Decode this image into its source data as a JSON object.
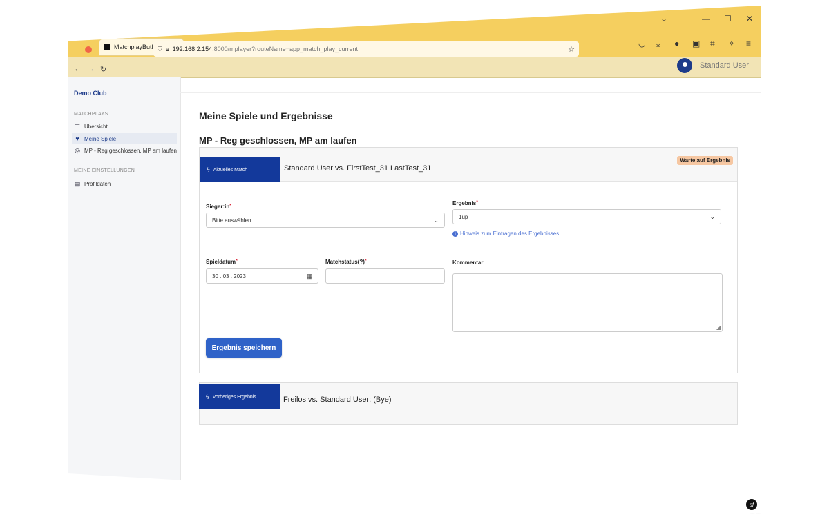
{
  "browser": {
    "tab_title": "MatchplayButler",
    "tab_close": "×",
    "new_tab": "+",
    "url_host": "192.168.2.154",
    "url_path": ":8000/mplayer?routeName=app_match_play_current",
    "minimize": "—",
    "maximize": "☐",
    "close": "✕",
    "dropdown": "⌄"
  },
  "sidebar": {
    "brand": "Demo Club",
    "section_matchplays": "MATCHPLAYS",
    "items": [
      {
        "label": "Übersicht",
        "icon": "list-icon"
      },
      {
        "label": "Meine Spiele",
        "icon": "heart-icon"
      },
      {
        "label": "MP - Reg geschlossen, MP am laufen",
        "icon": "target-icon"
      }
    ],
    "section_settings": "MEINE EINSTELLUNGEN",
    "settings_items": [
      {
        "label": "Profildaten",
        "icon": "id-card-icon"
      }
    ]
  },
  "header": {
    "user_name": "Standard User"
  },
  "main": {
    "page_title": "Meine Spiele und Ergebnisse",
    "section_title": "MP - Reg geschlossen, MP am laufen",
    "current": {
      "flag_label": "Aktuelles Match",
      "match_title": "Standard User vs. FirstTest_31 LastTest_31",
      "status_badge": "Warte auf Ergebnis"
    },
    "form": {
      "winner_label": "Sieger:in",
      "winner_value": "Bitte auswählen",
      "result_label": "Ergebnis",
      "result_value": "1up",
      "hint_text": "Hinweis zum Eintragen des Ergebnisses",
      "date_label": "Spieldatum",
      "date_value": "30 . 03 . 2023",
      "status_label": "Matchstatus(?)",
      "status_value": "",
      "comment_label": "Kommentar",
      "required_mark": "*",
      "save_label": "Ergebnis speichern"
    },
    "previous": {
      "flag_label": "Vorheriges Ergebnis",
      "match_title": "Freilos vs. Standard User:  (Bye)"
    }
  },
  "footer": {
    "symfony_badge": "sf"
  },
  "colors": {
    "accent": "#13399b",
    "button": "#2f62c8",
    "badge": "#f6c7a2"
  }
}
